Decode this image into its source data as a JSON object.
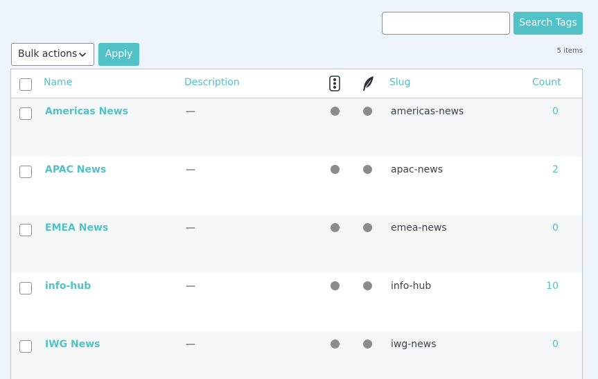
{
  "search": {
    "placeholder": "",
    "value": "",
    "button_label": "Search Tags"
  },
  "bulk": {
    "selected": "Bulk actions",
    "apply_label": "Apply"
  },
  "items_count": "5 items",
  "colors": {
    "accent": "#52c2c9",
    "dot": "#8c8c8c",
    "row_alt": "#f6f7f7"
  },
  "table": {
    "headers": {
      "name": "Name",
      "description": "Description",
      "icon1": "traffic-light-icon",
      "icon2": "feather-icon",
      "slug": "Slug",
      "count": "Count"
    },
    "rows": [
      {
        "name": "Americas News",
        "description": "—",
        "slug": "americas-news",
        "count": "0"
      },
      {
        "name": "APAC News",
        "description": "—",
        "slug": "apac-news",
        "count": "2"
      },
      {
        "name": "EMEA News",
        "description": "—",
        "slug": "emea-news",
        "count": "0"
      },
      {
        "name": "info-hub",
        "description": "—",
        "slug": "info-hub",
        "count": "10"
      },
      {
        "name": "IWG News",
        "description": "—",
        "slug": "iwg-news",
        "count": "0"
      }
    ]
  }
}
